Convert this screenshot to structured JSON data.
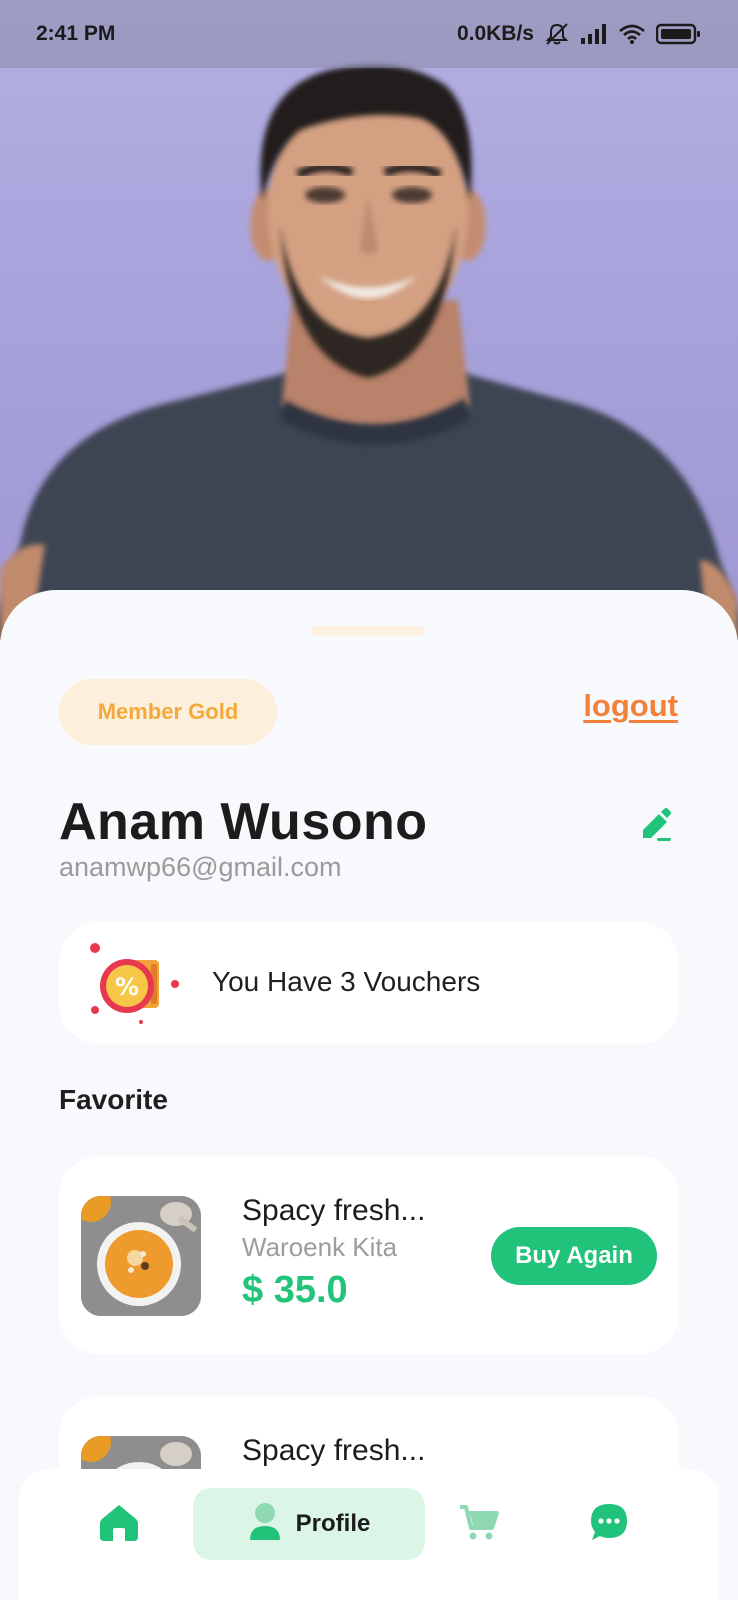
{
  "status_bar": {
    "time": "2:41 PM",
    "network_speed": "0.0KB/s",
    "icons": [
      "mute-icon",
      "signal-icon",
      "wifi-icon",
      "battery-icon"
    ]
  },
  "profile": {
    "member_badge": "Member Gold",
    "logout_label": "logout",
    "name": "Anam Wusono",
    "email": "anamwp66@gmail.com"
  },
  "voucher": {
    "text": "You Have 3 Vouchers"
  },
  "favorites": {
    "title": "Favorite",
    "items": [
      {
        "name": "Spacy fresh...",
        "store": "Waroenk Kita",
        "price": "$ 35.0",
        "button_label": "Buy Again"
      },
      {
        "name": "Spacy fresh..."
      }
    ]
  },
  "bottom_nav": {
    "items": [
      {
        "icon": "home-icon"
      },
      {
        "icon": "profile-icon",
        "label": "Profile",
        "active": true
      },
      {
        "icon": "cart-icon"
      },
      {
        "icon": "chat-icon"
      }
    ]
  },
  "colors": {
    "accent_green": "#21c27a",
    "accent_orange": "#f0823c",
    "badge_gold": "#f4a93a",
    "badge_bg": "#fcf0dc",
    "hero_bg": "#ada8de"
  }
}
